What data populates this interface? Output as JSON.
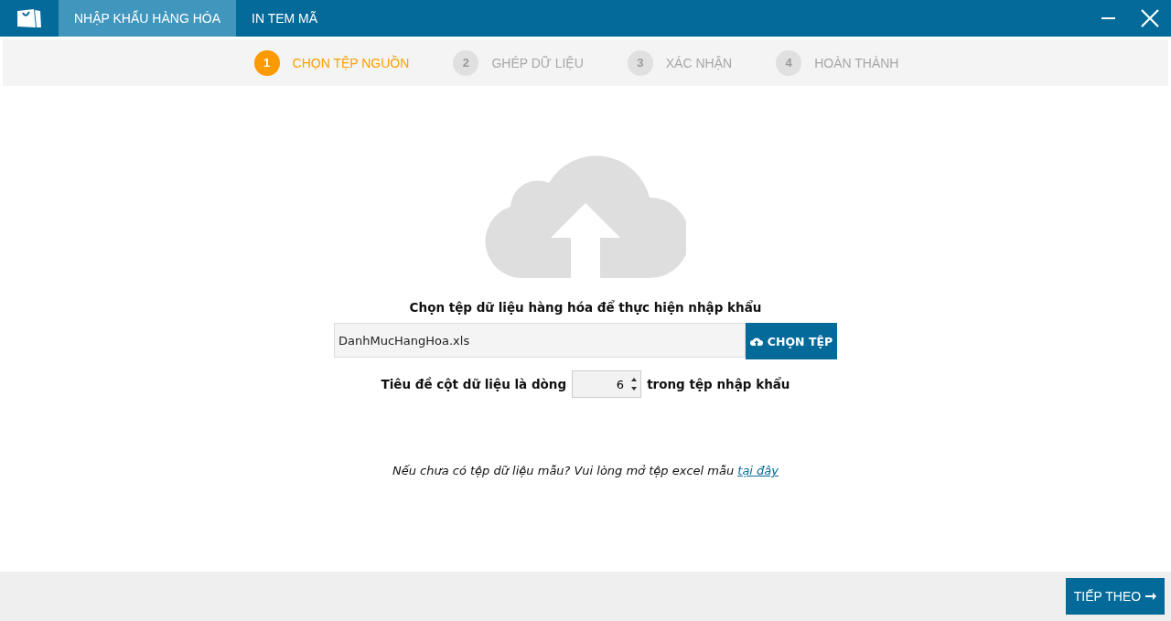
{
  "tabs": [
    {
      "label": "NHẬP KHẨU HÀNG HÓA",
      "selected": true
    },
    {
      "label": "IN TEM MÃ",
      "selected": false
    }
  ],
  "steps": [
    {
      "number": "1",
      "label": "CHỌN TỆP NGUỒN",
      "selected": true
    },
    {
      "number": "2",
      "label": "GHÉP DỮ LIỆU",
      "selected": false
    },
    {
      "number": "3",
      "label": "XÁC NHẬN",
      "selected": false
    },
    {
      "number": "4",
      "label": "HOÀN THÀNH",
      "selected": false
    }
  ],
  "upload": {
    "heading": "Chọn tệp dữ liệu hàng hóa để thực hiện nhập khẩu",
    "file_value": "DanhMucHangHoa.xls",
    "choose_button": "CHỌN TỆP"
  },
  "header_row": {
    "label_before": "Tiêu đề cột dữ liệu là dòng",
    "value": "6",
    "label_after": "trong tệp nhập khẩu"
  },
  "hint": {
    "text": "Nếu chưa có tệp dữ liệu mẫu? Vui lòng mở tệp excel mẫu",
    "link": "tại đây"
  },
  "next_button": "TIẾP THEO"
}
